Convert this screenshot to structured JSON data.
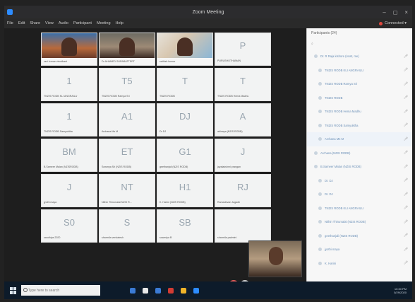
{
  "window": {
    "title": "Zoom Meeting",
    "controls": [
      "–",
      "◻",
      "×"
    ]
  },
  "menubar": {
    "items": [
      "File",
      "Edit",
      "Share",
      "View",
      "Audio",
      "Participant",
      "Meeting",
      "Help"
    ],
    "status": "Connected ▾"
  },
  "gallery": {
    "tiles": [
      {
        "initials": "",
        "caption": "ravi kumar vinodkant",
        "video": "vid1"
      },
      {
        "initials": "",
        "caption": "Dr AHAMED SURABATTERT",
        "video": "vid2"
      },
      {
        "initials": "",
        "caption": "sathish kumar",
        "video": "vid3"
      },
      {
        "initials": "P",
        "caption": "PURUSHOTHAMAN"
      },
      {
        "initials": "1",
        "caption": "TNZIS RODB KLI ANGRAILU"
      },
      {
        "initials": "T5",
        "caption": "TNZIS RODB Ramya Sri"
      },
      {
        "initials": "T",
        "caption": "TNZIS RODB"
      },
      {
        "initials": "T",
        "caption": "TNZIS RODB Hema Madhu"
      },
      {
        "initials": "1",
        "caption": "TNZIS RODB Samyuktha"
      },
      {
        "initials": "A1",
        "caption": "Archana Ms M"
      },
      {
        "initials": "DJ",
        "caption": "Dr DJ"
      },
      {
        "initials": "A",
        "caption": "abinaya (NZIS RODB)"
      },
      {
        "initials": "BM",
        "caption": "B.Sameer Malan (NZISRODB)"
      },
      {
        "initials": "ET",
        "caption": "Sowmya Sri (NZIS RODB)"
      },
      {
        "initials": "G1",
        "caption": "geethanjali (NZIS RODB)"
      },
      {
        "initials": "J",
        "caption": "jayalakshmi prangan"
      },
      {
        "initials": "J",
        "caption": "jyothi maya"
      },
      {
        "initials": "NT",
        "caption": "Nithin Thirumalai NZIS R..."
      },
      {
        "initials": "H1",
        "caption": "K. Harini (NZIS RODB)"
      },
      {
        "initials": "RJ",
        "caption": "Ramadevan Jagadh"
      },
      {
        "initials": "S0",
        "caption": "sandhiya 2020"
      },
      {
        "initials": "S",
        "caption": "sharmila venkatesh"
      },
      {
        "initials": "SB",
        "caption": "sowmiya B"
      },
      {
        "initials": "",
        "caption": "sharmila padmini"
      }
    ]
  },
  "panel": {
    "header": "Participants (24)",
    "search_placeholder": "",
    "rows": [
      {
        "label": "Dr. R Raja kishore (Host, me)",
        "indent": false,
        "highlight": false
      },
      {
        "label": "TNZIS RODB KLI ANGRAILU",
        "indent": true,
        "highlight": false
      },
      {
        "label": "TNZIS RODB Ramya Sri",
        "indent": true,
        "highlight": false
      },
      {
        "label": "TNZIS RODB",
        "indent": true,
        "highlight": false
      },
      {
        "label": "TNZIS RODB Hema Madhu",
        "indent": true,
        "highlight": false
      },
      {
        "label": "TNZIS RODB Samyuktha",
        "indent": true,
        "highlight": false
      },
      {
        "label": "Archana Ms M",
        "indent": true,
        "highlight": true
      },
      {
        "label": "Archana (NZIS RODB)",
        "indent": false,
        "highlight": false
      },
      {
        "label": "B.Sameer Malan (NZIS RODB)",
        "indent": false,
        "highlight": false
      },
      {
        "label": "Dr. DJ",
        "indent": true,
        "highlight": false
      },
      {
        "label": "Dr. DJ",
        "indent": true,
        "highlight": false
      },
      {
        "label": "TNZIS RODB KLI ANGRAILU",
        "indent": true,
        "highlight": false
      },
      {
        "label": "Nithin Thirumalai (NZIS RODB)",
        "indent": true,
        "highlight": false
      },
      {
        "label": "geethanjali (NZIS RODB)",
        "indent": true,
        "highlight": false
      },
      {
        "label": "jyothi maya",
        "indent": true,
        "highlight": false
      },
      {
        "label": "K. Harini",
        "indent": true,
        "highlight": false
      }
    ]
  },
  "taskbar": {
    "search_placeholder": "Type here to search",
    "clock_time": "10:30 PM",
    "clock_date": "5/29/2020",
    "app_colors": [
      "#3b7bd5",
      "#e8e8e8",
      "#3b7bd5",
      "#d23c33",
      "#f0b429",
      "#2d8cff"
    ]
  }
}
